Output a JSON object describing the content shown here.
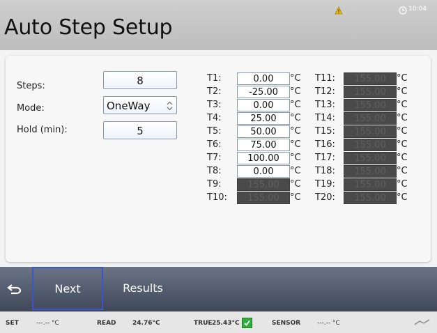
{
  "header": {
    "title": "Auto Step Setup",
    "clock_text": "10:04"
  },
  "settings": {
    "steps": {
      "label": "Steps:",
      "value": "8"
    },
    "mode": {
      "label": "Mode:",
      "value": "OneWay"
    },
    "hold": {
      "label": "Hold (min):",
      "value": "5"
    }
  },
  "unit": "°C",
  "temps_left": [
    {
      "label": "T1:",
      "value": "0.00",
      "enabled": true
    },
    {
      "label": "T2:",
      "value": "-25.00",
      "enabled": true
    },
    {
      "label": "T3:",
      "value": "0.00",
      "enabled": true
    },
    {
      "label": "T4:",
      "value": "25.00",
      "enabled": true
    },
    {
      "label": "T5:",
      "value": "50.00",
      "enabled": true
    },
    {
      "label": "T6:",
      "value": "75.00",
      "enabled": true
    },
    {
      "label": "T7:",
      "value": "100.00",
      "enabled": true
    },
    {
      "label": "T8:",
      "value": "0.00",
      "enabled": true
    },
    {
      "label": "T9:",
      "value": "155.00",
      "enabled": false
    },
    {
      "label": "T10:",
      "value": "155.00",
      "enabled": false
    }
  ],
  "temps_right": [
    {
      "label": "T11:",
      "value": "155.00",
      "enabled": false
    },
    {
      "label": "T12:",
      "value": "155.00",
      "enabled": false
    },
    {
      "label": "T13:",
      "value": "155.00",
      "enabled": false
    },
    {
      "label": "T14:",
      "value": "155.00",
      "enabled": false
    },
    {
      "label": "T15:",
      "value": "155.00",
      "enabled": false
    },
    {
      "label": "T16:",
      "value": "155.00",
      "enabled": false
    },
    {
      "label": "T17:",
      "value": "155.00",
      "enabled": false
    },
    {
      "label": "T18:",
      "value": "155.00",
      "enabled": false
    },
    {
      "label": "T19:",
      "value": "155.00",
      "enabled": false
    },
    {
      "label": "T20:",
      "value": "155.00",
      "enabled": false
    }
  ],
  "nav": {
    "next_label": "Next",
    "results_label": "Results"
  },
  "status": {
    "set_label": "SET",
    "set_value": "---.-- °C",
    "read_label": "READ",
    "read_value": "24.76°C",
    "true_label": "TRUE",
    "true_value": "25.43°C",
    "sensor_label": "SENSOR",
    "sensor_value": "---.-- °C"
  },
  "colors": {
    "header_bg": "#c6c6c6",
    "nav_bg": "#4c5468",
    "next_border": "#3d55c8",
    "disabled_field": "#4a4a4a",
    "check_green": "#2fae3c",
    "warn_yellow": "#f2c200"
  }
}
